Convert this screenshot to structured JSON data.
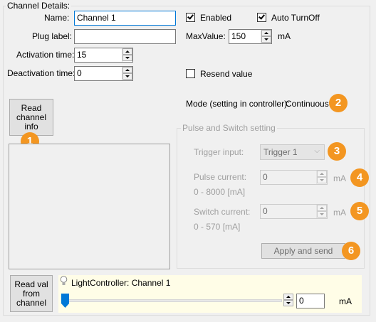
{
  "channel_details": {
    "legend": "Channel Details:",
    "name_label": "Name:",
    "name_value": "Channel 1",
    "plug_label": "Plug label:",
    "plug_value": "",
    "activation_label": "Activation time:",
    "activation_value": "15",
    "deactivation_label": "Deactivation time:",
    "deactivation_value": "0",
    "enabled_label": "Enabled",
    "enabled_checked": true,
    "auto_turnoff_label": "Auto TurnOff",
    "auto_turnoff_checked": true,
    "maxvalue_label": "MaxValue:",
    "maxvalue_value": "150",
    "maxvalue_unit": "mA",
    "resend_label": "Resend value",
    "resend_checked": false,
    "read_channel_info_label": [
      "Read",
      "channel",
      "info"
    ],
    "mode_label": "Mode (setting in controller):",
    "mode_value": "Continuous"
  },
  "pulse_switch": {
    "legend": "Pulse and Switch setting",
    "trigger_label": "Trigger input:",
    "trigger_value": "Trigger 1",
    "pulse_label": "Pulse current:",
    "pulse_value": "0",
    "pulse_unit": "mA",
    "pulse_range": "0 - 8000 [mA]",
    "switch_label": "Switch current:",
    "switch_value": "0",
    "switch_unit": "mA",
    "switch_range": "0 - 570 [mA]",
    "apply_label": "Apply and send"
  },
  "bottom": {
    "read_val_label": [
      "Read val",
      "from",
      "channel"
    ],
    "controller_title": "LightController: Channel 1",
    "slider_value": 0,
    "value": "0",
    "unit": "mA"
  },
  "badges": [
    "1",
    "2",
    "3",
    "4",
    "5",
    "6"
  ],
  "colors": {
    "badge": "#f39621",
    "focus": "#0078d7",
    "panel_highlight": "#fffde7"
  },
  "icons": {
    "bulb": "lightbulb-icon"
  }
}
